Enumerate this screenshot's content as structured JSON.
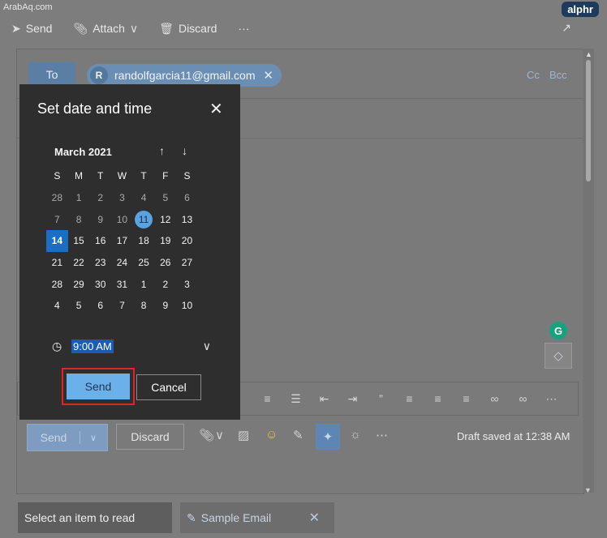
{
  "watermark": "ArabAq.com",
  "brand": "alphr",
  "toolbar": {
    "send_label": "Send",
    "attach_label": "Attach",
    "discard_label": "Discard",
    "more_label": "···"
  },
  "recipient": {
    "to_label": "To",
    "initial": "R",
    "email": "randolfgarcia11@gmail.com",
    "cc_label": "Cc",
    "bcc_label": "Bcc"
  },
  "grammarly_letter": "G",
  "bottom": {
    "send_label": "Send",
    "discard_label": "Discard",
    "draft_status": "Draft saved at 12:38 AM"
  },
  "status": {
    "select_item": "Select an item to read",
    "tab_label": "Sample Email"
  },
  "dialog": {
    "title": "Set date and time",
    "month": "March 2021",
    "weekdays": [
      "S",
      "M",
      "T",
      "W",
      "T",
      "F",
      "S"
    ],
    "weeks": [
      [
        "28",
        "1",
        "2",
        "3",
        "4",
        "5",
        "6"
      ],
      [
        "7",
        "8",
        "9",
        "10",
        "11",
        "12",
        "13"
      ],
      [
        "14",
        "15",
        "16",
        "17",
        "18",
        "19",
        "20"
      ],
      [
        "21",
        "22",
        "23",
        "24",
        "25",
        "26",
        "27"
      ],
      [
        "28",
        "29",
        "30",
        "31",
        "1",
        "2",
        "3"
      ],
      [
        "4",
        "5",
        "6",
        "7",
        "8",
        "9",
        "10"
      ]
    ],
    "time": "9:00 AM",
    "send_label": "Send",
    "cancel_label": "Cancel"
  },
  "colors": {
    "accent": "#1a6fc4",
    "today": "#5ba2e0",
    "highlight_box": "#e0242a"
  }
}
